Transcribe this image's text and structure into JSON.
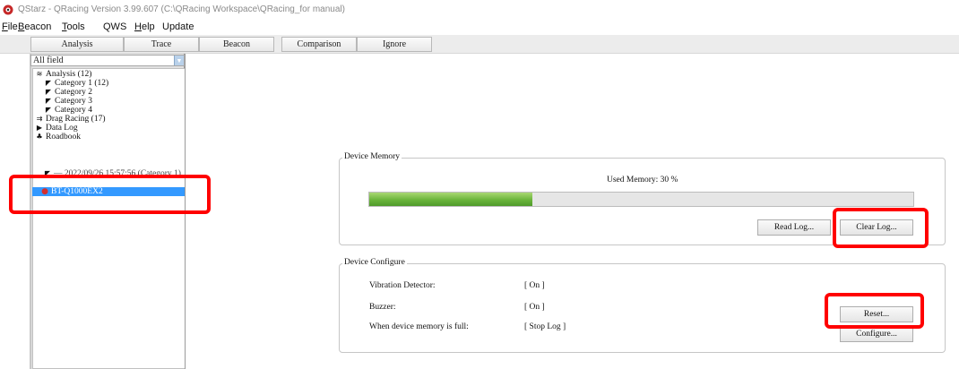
{
  "window": {
    "title": "QStarz - QRacing Version 3.99.607 (C:\\QRacing Workspace\\QRacing_for manual)"
  },
  "menu": {
    "items": [
      {
        "first": "F",
        "rest": "ile"
      },
      {
        "first": "B",
        "rest": "eacon"
      },
      {
        "first": "T",
        "rest": "ools"
      },
      {
        "first": "",
        "rest": "QWS"
      },
      {
        "first": "H",
        "rest": "elp"
      },
      {
        "first": "",
        "rest": "Update"
      }
    ]
  },
  "toolbar": {
    "buttons": [
      "Analysis",
      "Trace",
      "Beacon",
      "Comparison",
      "Ignore"
    ]
  },
  "sidebar": {
    "filter": "All field",
    "tree": [
      {
        "icon": "analysis-icon",
        "label": "Analysis (12)"
      },
      {
        "icon": "flag-icon",
        "label": "Category 1 (12)"
      },
      {
        "icon": "flag-icon",
        "label": "Category 2"
      },
      {
        "icon": "flag-icon",
        "label": "Category 3"
      },
      {
        "icon": "flag-icon",
        "label": "Category 4"
      },
      {
        "icon": "drag-racing-icon",
        "label": "Drag Racing (17)"
      },
      {
        "icon": "data-log-icon",
        "label": "Data Log"
      },
      {
        "icon": "roadbook-icon",
        "label": "Roadbook"
      }
    ],
    "session": "2022/09/26 15:57:56 (Category 1)",
    "device": "BT-Q1000EX2"
  },
  "device_memory": {
    "title": "Device Memory",
    "used_label": "Used Memory: 30 %",
    "used_fraction": 0.3,
    "read_button": "Read Log...",
    "clear_button": "Clear Log..."
  },
  "device_configure": {
    "title": "Device Configure",
    "rows": [
      {
        "label": "Vibration Detector:",
        "value": "[ On ]"
      },
      {
        "label": "Buzzer:",
        "value": "[ On ]"
      },
      {
        "label": "When device memory is full:",
        "value": "[ Stop Log ]"
      }
    ],
    "reset_button": "Reset...",
    "configure_button": "Configure..."
  },
  "colors": {
    "highlight": "#ff0000",
    "selection": "#3399ff",
    "progress": "#6ab43b"
  }
}
